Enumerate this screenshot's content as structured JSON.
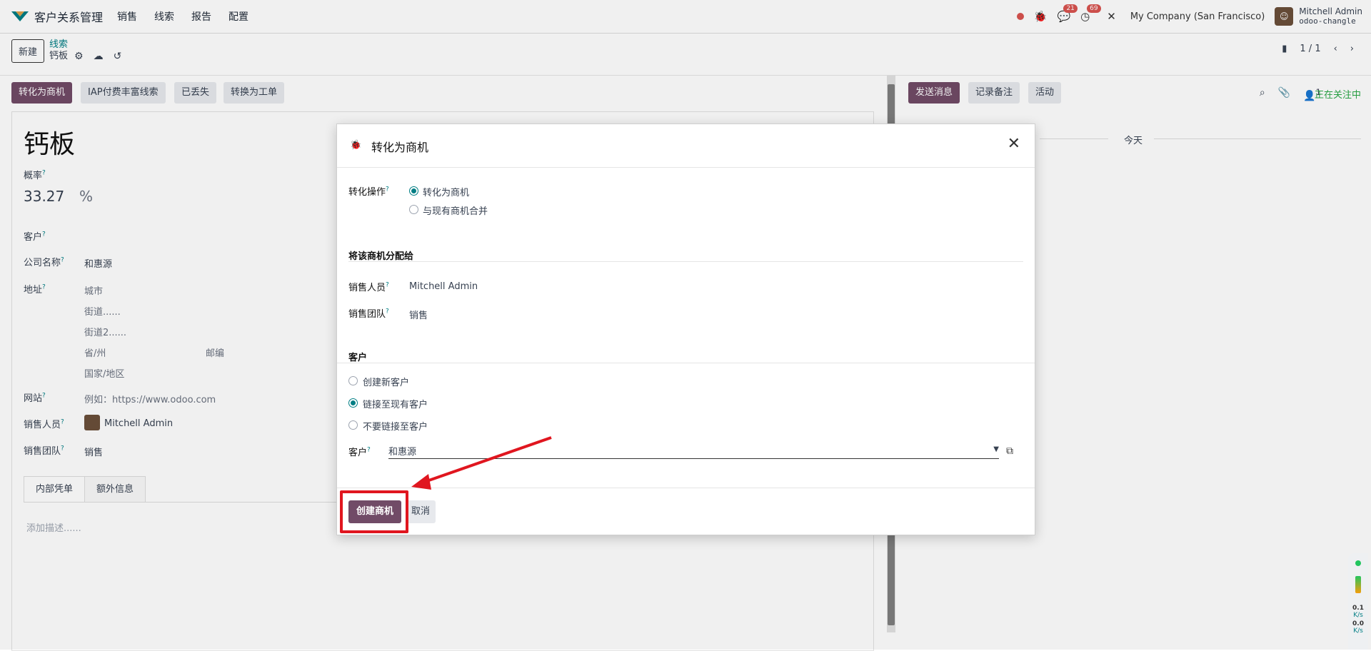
{
  "navbar": {
    "app_name": "客户关系管理",
    "menu": [
      "销售",
      "线索",
      "报告",
      "配置"
    ],
    "chat_badge": "21",
    "activity_badge": "69",
    "company": "My Company (San Francisco)",
    "user_name": "Mitchell Admin",
    "db_name": "odoo-changle"
  },
  "control": {
    "new_button": "新建",
    "breadcrumb_parent": "线索",
    "breadcrumb_current": "钙板",
    "pager": "1 / 1"
  },
  "statusbar": {
    "convert": "转化为商机",
    "iap": "IAP付费丰富线索",
    "lost": "已丢失",
    "to_ticket": "转换为工单"
  },
  "form": {
    "title": "钙板",
    "probability_label": "概率",
    "probability_value": "33.27",
    "percent": "%",
    "customer_label": "客户",
    "company_label": "公司名称",
    "company_value": "和惠源",
    "address_label": "地址",
    "city": "城市",
    "street": "街道......",
    "street2": "街道2......",
    "state": "省/州",
    "zip": "邮编",
    "country": "国家/地区",
    "website_label": "网站",
    "website_placeholder": "例如：https://www.odoo.com",
    "salesperson_label": "销售人员",
    "salesperson_value": "Mitchell Admin",
    "team_label": "销售团队",
    "team_value": "销售",
    "tabs": [
      "内部凭单",
      "额外信息"
    ],
    "description_placeholder": "添加描述......"
  },
  "chatter": {
    "send_message": "发送消息",
    "log_note": "记录备注",
    "activity": "活动",
    "followers_count": "1",
    "following": "正在关注中",
    "today": "今天"
  },
  "modal": {
    "title": "转化为商机",
    "conversion_label": "转化操作",
    "opt_convert": "转化为商机",
    "opt_merge": "与现有商机合并",
    "assign_section": "将该商机分配给",
    "salesperson_label": "销售人员",
    "salesperson_value": "Mitchell Admin",
    "team_label": "销售团队",
    "team_value": "销售",
    "customer_section": "客户",
    "opt_create_customer": "创建新客户",
    "opt_link_customer": "链接至现有客户",
    "opt_no_link": "不要链接至客户",
    "customer_label": "客户",
    "customer_value": "和惠源",
    "create_button": "创建商机",
    "cancel_button": "取消"
  },
  "widget": {
    "up_speed": "0.1",
    "up_unit": "K/s",
    "down_speed": "0.0",
    "down_unit": "K/s"
  },
  "colors": {
    "primary": "#714b67",
    "accent": "#017e84",
    "annotation": "#e0161f"
  }
}
